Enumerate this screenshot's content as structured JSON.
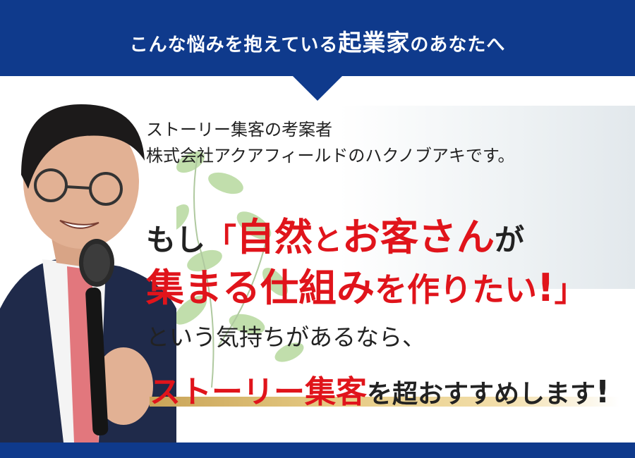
{
  "banner": {
    "text_prefix": "こんな悩みを抱えている",
    "text_emphasis": "起業家",
    "text_suffix": "のあなたへ"
  },
  "intro": {
    "line1": "ストーリー集客の考案者",
    "line2": "株式会社アクアフィールドのハクノブアキです。"
  },
  "headline": {
    "l1_pre": "もし",
    "l1_bracket": "「",
    "l1_red1": "自然",
    "l1_mid": "と",
    "l1_red2": "お客さん",
    "l1_post": "が",
    "l2_red": "集まる仕組み",
    "l2_mid": "を作りたい",
    "l2_excl": "!",
    "l2_bracket": "」"
  },
  "sub_text": "という気持ちがあるなら、",
  "final": {
    "red": "ストーリー集客",
    "rest": "を超おすすめします",
    "excl": "!"
  },
  "colors": {
    "navy": "#0f3a8c",
    "red": "#e0141b",
    "gold": "#c9a458"
  }
}
